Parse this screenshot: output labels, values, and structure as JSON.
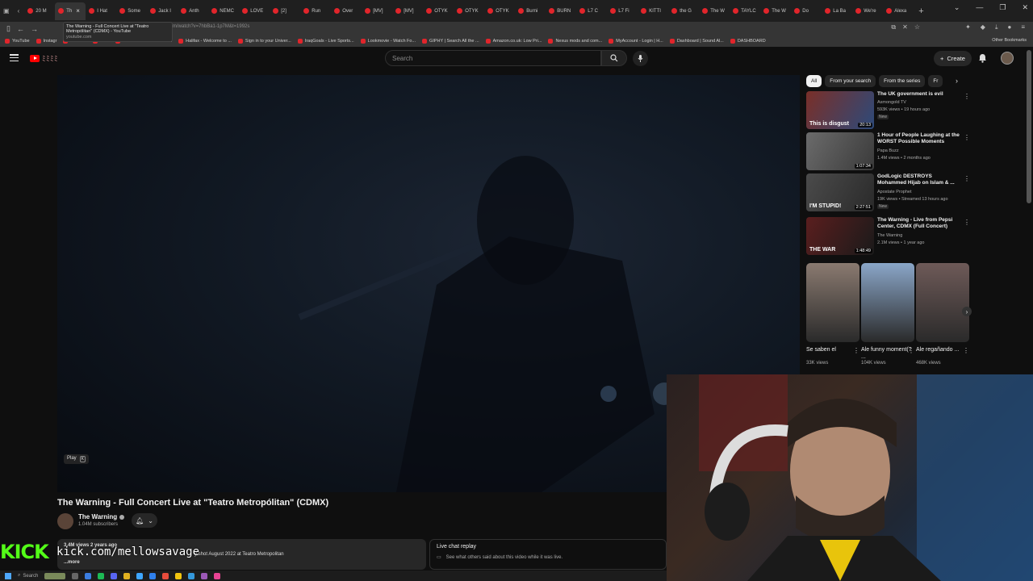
{
  "browser": {
    "tabs": [
      {
        "label": "20 M"
      },
      {
        "label": "Th",
        "active": true
      },
      {
        "label": "I Hat"
      },
      {
        "label": "Some"
      },
      {
        "label": "Jack I"
      },
      {
        "label": "Anth"
      },
      {
        "label": "NEMC"
      },
      {
        "label": "LOVE"
      },
      {
        "label": "[2]"
      },
      {
        "label": "Run"
      },
      {
        "label": "Over"
      },
      {
        "label": "[MV]"
      },
      {
        "label": "[MV]"
      },
      {
        "label": "OTYK"
      },
      {
        "label": "OTYK"
      },
      {
        "label": "OTYK"
      },
      {
        "label": "Burni"
      },
      {
        "label": "BURN"
      },
      {
        "label": "L7 C"
      },
      {
        "label": "L7 Fi"
      },
      {
        "label": "KITTI"
      },
      {
        "label": "the G"
      },
      {
        "label": "The W"
      },
      {
        "label": "TAYLC"
      },
      {
        "label": "The W"
      },
      {
        "label": "Do"
      },
      {
        "label": "La Ba"
      },
      {
        "label": "We're"
      },
      {
        "label": "Alexa"
      }
    ],
    "tooltip": {
      "title": "The Warning - Full Concert Live at \"Teatro Metropólitan\" (CDMX) - YouTube",
      "domain": "youtube.com"
    },
    "url": "m/watch?v=7hbBa1-1p7M&t=1992s",
    "bookmarks": [
      "YouTube",
      "Instagr",
      "from x...",
      "Kick",
      "BandLab: Music Starts ...",
      "Halifax - Welcome to ...",
      "Sign in to your Univer...",
      "IraqGoals - Live Sports...",
      "Lookmovie - Watch Fo...",
      "GIPHY | Search All the ...",
      "Amazon.co.uk: Low Pri...",
      "Nexus mods and com...",
      "MyAccount - Login | H...",
      "Dashboard | Sound Al...",
      "DASHBOARD"
    ],
    "other_bookmarks": "Other Bookmarks"
  },
  "youtube": {
    "logo_text": "ﾐﾐﾐﾐ",
    "search_placeholder": "Search",
    "create_label": "Create",
    "player": {
      "play_hint": "Play",
      "play_key": "K"
    },
    "video": {
      "title": "The Warning - Full Concert Live at \"Teatro Metropólitan\" (CDMX)",
      "channel": "The Warning",
      "subscribers": "1.04M subscribers",
      "meta": "3.4M views  2 years ago",
      "description": "y shot August 2022 at Teatro Metropolitan",
      "more": "...more"
    },
    "chat_replay": {
      "title": "Live chat replay",
      "subtitle": "See what others said about this video while it was live."
    },
    "chips": [
      "All",
      "From your search",
      "From the series",
      "Fr"
    ],
    "recommendations": [
      {
        "title": "The UK government is evil",
        "channel": "Asmongold TV",
        "meta": "593K views • 19 hours ago",
        "badge": "New",
        "duration": "20:13",
        "overlay": "This is disgust",
        "color1": "#7a2f28",
        "color2": "#2d4a7a"
      },
      {
        "title": "1 Hour of People Laughing at the WORST Possible Moments",
        "channel": "Papa Buzz",
        "meta": "1.4M views • 2 months ago",
        "badge": "",
        "duration": "1:07:34",
        "overlay": "",
        "color1": "#6b6b6b",
        "color2": "#3a3a3a"
      },
      {
        "title": "GodLogic DESTROYS Mohammed Hijab on Islam & ...",
        "channel": "Apostate Prophet",
        "meta": "19K views • Streamed 13 hours ago",
        "badge": "New",
        "duration": "2:27:51",
        "overlay": "I'M STUPID!",
        "color1": "#4b4b4b",
        "color2": "#2a2a2a"
      },
      {
        "title": "The Warning - Live from Pepsi Center, CDMX (Full Concert)",
        "channel": "The Warning",
        "meta": "2.1M views • 1 year ago",
        "badge": "",
        "duration": "1:48:49",
        "overlay": "THE WAR",
        "color1": "#5a1e1e",
        "color2": "#1a1a1a"
      }
    ],
    "shorts": [
      {
        "title": "Se saben el",
        "views": "33K views",
        "color": "#8a7a70"
      },
      {
        "title": "Ale funny moment(? ...",
        "views": "104K views",
        "color": "#8aa6c8"
      },
      {
        "title": "Ale regañando ...",
        "views": "468K views",
        "color": "#6e5a58"
      }
    ]
  },
  "overlay": {
    "kick_logo": "KICK",
    "kick_url": "kick.com/mellowsavage"
  },
  "taskbar": {
    "search_label": "Search"
  }
}
